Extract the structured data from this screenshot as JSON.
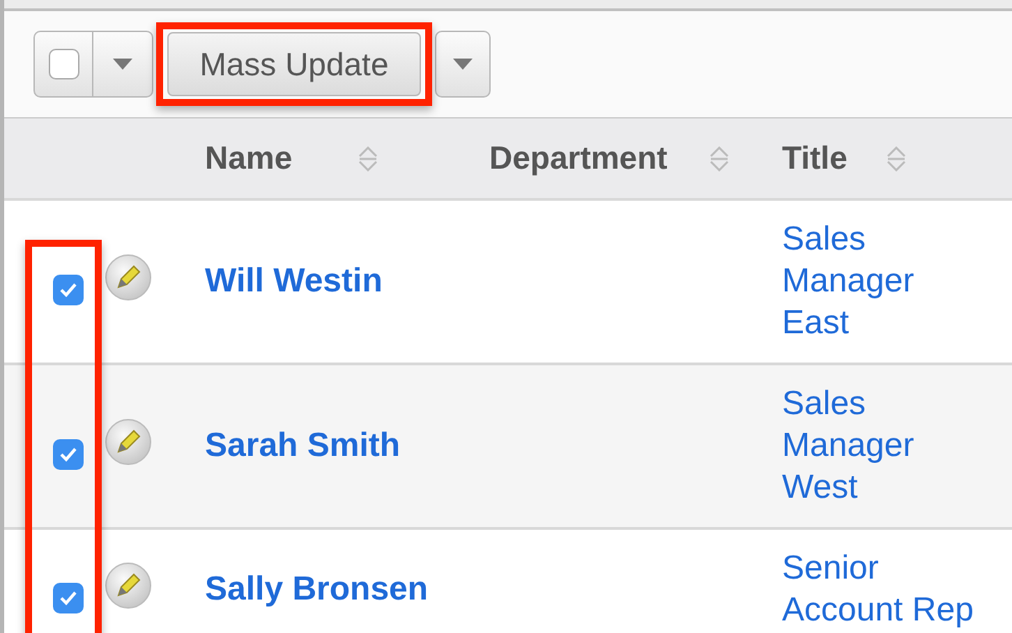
{
  "toolbar": {
    "select_all_checked": false,
    "mass_update": {
      "label": "Mass Update",
      "highlighted": true
    }
  },
  "table": {
    "columns": [
      {
        "label": "Name"
      },
      {
        "label": "Department"
      },
      {
        "label": "Title"
      }
    ],
    "checkbox_column_highlighted": true,
    "rows": [
      {
        "checked": true,
        "name": "Will Westin",
        "department": "",
        "title_lines": [
          "Sales",
          "Manager",
          "East"
        ]
      },
      {
        "checked": true,
        "name": "Sarah Smith",
        "department": "",
        "title_lines": [
          "Sales",
          "Manager",
          "West"
        ]
      },
      {
        "checked": true,
        "name": "Sally Bronsen",
        "department": "",
        "title_lines": [
          "Senior",
          "Account Rep"
        ]
      }
    ]
  }
}
